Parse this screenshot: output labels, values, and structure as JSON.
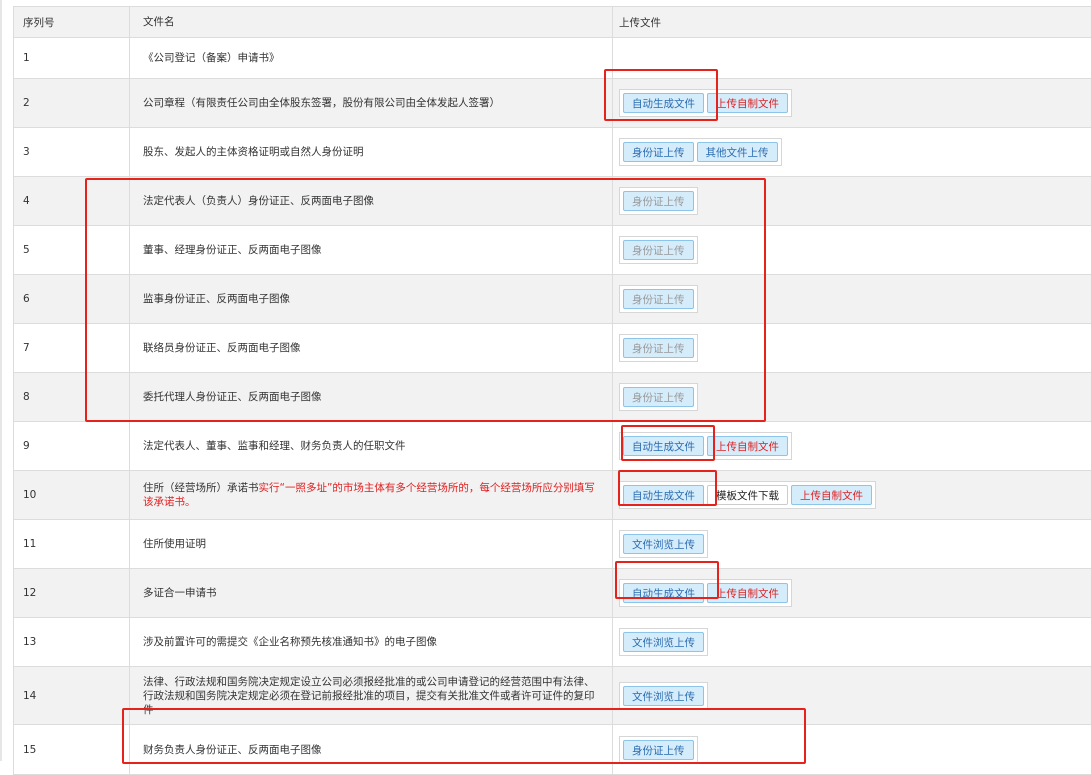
{
  "table": {
    "headers": [
      "序列号",
      "文件名",
      "上传文件"
    ],
    "rows": [
      {
        "index": "1",
        "name": "《公司登记（备案）申请书》",
        "buttons": []
      },
      {
        "index": "2",
        "name": "公司章程（有限责任公司由全体股东签署，股份有限公司由全体发起人签署）",
        "buttons": [
          "自动生成文件",
          "上传自制文件"
        ]
      },
      {
        "index": "3",
        "name": "股东、发起人的主体资格证明或自然人身份证明",
        "buttons": [
          "身份证上传",
          "其他文件上传"
        ]
      },
      {
        "index": "4",
        "name": "法定代表人（负责人）身份证正、反两面电子图像",
        "buttons": [
          "身份证上传"
        ]
      },
      {
        "index": "5",
        "name": "董事、经理身份证正、反两面电子图像",
        "buttons": [
          "身份证上传"
        ]
      },
      {
        "index": "6",
        "name": "监事身份证正、反两面电子图像",
        "buttons": [
          "身份证上传"
        ]
      },
      {
        "index": "7",
        "name": "联络员身份证正、反两面电子图像",
        "buttons": [
          "身份证上传"
        ]
      },
      {
        "index": "8",
        "name": "委托代理人身份证正、反两面电子图像",
        "buttons": [
          "身份证上传"
        ]
      },
      {
        "index": "9",
        "name": "法定代表人、董事、监事和经理、财务负责人的任职文件",
        "buttons": [
          "自动生成文件",
          "上传自制文件"
        ]
      },
      {
        "index": "10",
        "name": "住所（经营场所）承诺书",
        "name_warning": "实行“一照多址”的市场主体有多个经营场所的，每个经营场所应分别填写该承诺书。",
        "buttons": [
          "自动生成文件",
          "模板文件下载",
          "上传自制文件"
        ]
      },
      {
        "index": "11",
        "name": "住所使用证明",
        "buttons": [
          "文件浏览上传"
        ]
      },
      {
        "index": "12",
        "name": "多证合一申请书",
        "buttons": [
          "自动生成文件",
          "上传自制文件"
        ]
      },
      {
        "index": "13",
        "name": "涉及前置许可的需提交《企业名称预先核准通知书》的电子图像",
        "buttons": [
          "文件浏览上传"
        ]
      },
      {
        "index": "14",
        "name": "法律、行政法规和国务院决定规定设立公司必须报经批准的或公司申请登记的经营范围中有法律、行政法规和国务院决定规定必须在登记前报经批准的项目，提交有关批准文件或者许可证件的复印件",
        "buttons": [
          "文件浏览上传"
        ]
      },
      {
        "index": "15",
        "name": "财务负责人身份证正、反两面电子图像",
        "buttons": [
          "身份证上传"
        ]
      }
    ]
  },
  "colors": {
    "highlight": "#e5231c",
    "button_bg": "#d5ecfb",
    "button_text": "#2b6cb0",
    "self_upload_text": "#e02020"
  }
}
